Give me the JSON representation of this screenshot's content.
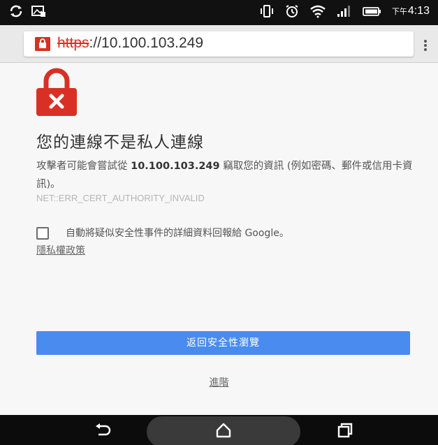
{
  "status_bar": {
    "time_prefix": "下午",
    "time": "4:13",
    "icons": [
      "sync-icon",
      "image-icon",
      "vibrate-icon",
      "alarm-icon",
      "wifi-icon",
      "signal-icon",
      "battery-icon"
    ]
  },
  "toolbar": {
    "url_scheme": "https",
    "url_rest": "://10.100.103.249",
    "security_state": "insecure",
    "accent_color": "#d93025"
  },
  "interstitial": {
    "heading": "您的連線不是私人連線",
    "body_pre": "攻擊者可能會嘗試從 ",
    "body_host": "10.100.103.249",
    "body_post": " 竊取您的資訊 (例如密碼、郵件或信用卡資訊)。",
    "error_code": "NET::ERR_CERT_AUTHORITY_INVALID",
    "checkbox_label": "自動將疑似安全性事件的詳細資料回報給 Google。",
    "checkbox_checked": false,
    "privacy_link": "隱私權政策",
    "primary_button": "返回安全性瀏覽",
    "advanced_link": "進階",
    "button_color": "#4a8bf0"
  },
  "nav_bar": {
    "buttons": [
      "back-icon",
      "home-icon",
      "recents-icon"
    ]
  }
}
